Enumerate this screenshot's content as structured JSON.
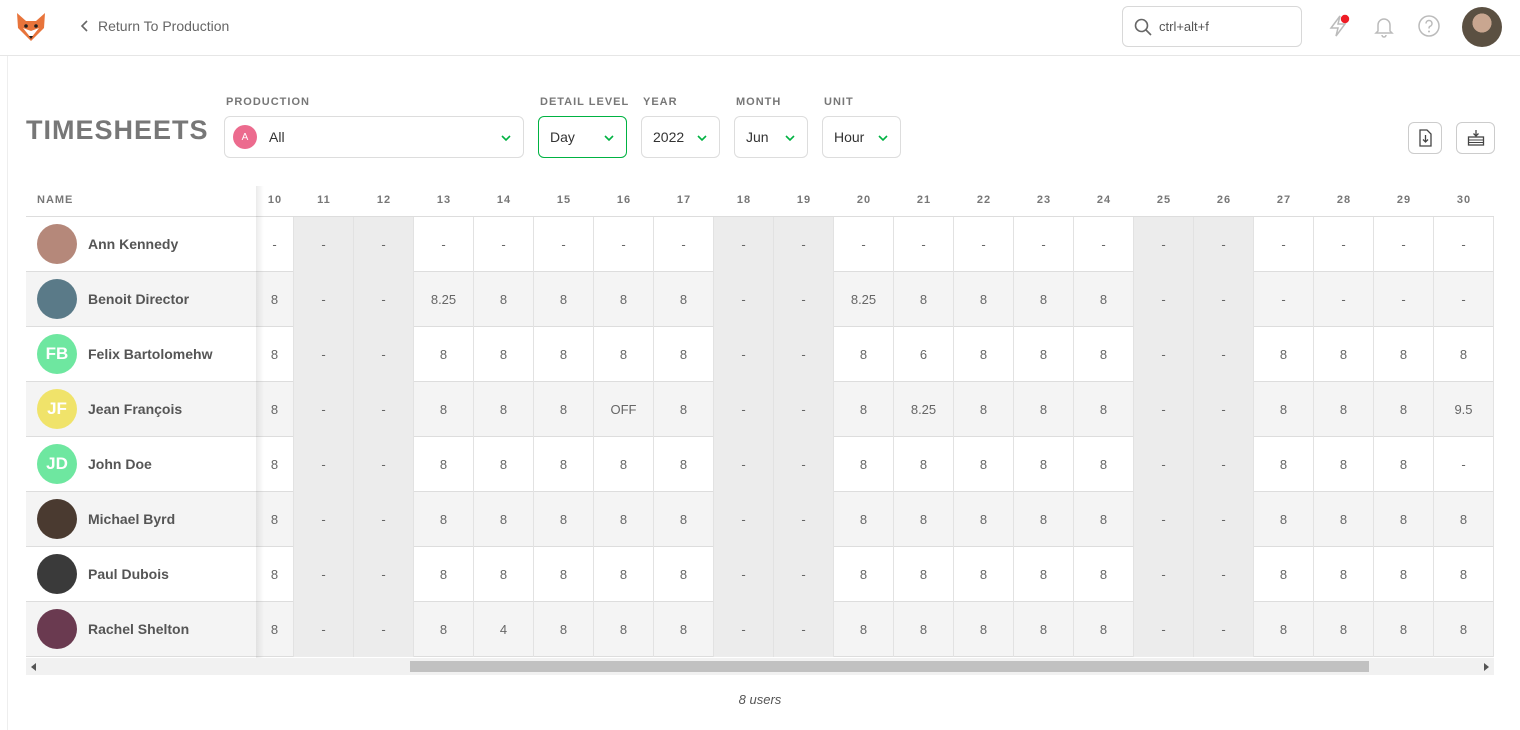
{
  "topbar": {
    "back_label": "Return To Production",
    "search_placeholder": "ctrl+alt+f"
  },
  "page": {
    "title": "TIMESHEETS"
  },
  "filters": {
    "production": {
      "label": "PRODUCTION",
      "value": "All",
      "badge": "A"
    },
    "detail_level": {
      "label": "DETAIL LEVEL",
      "value": "Day"
    },
    "year": {
      "label": "YEAR",
      "value": "2022"
    },
    "month": {
      "label": "MONTH",
      "value": "Jun"
    },
    "unit": {
      "label": "UNIT",
      "value": "Hour"
    }
  },
  "table": {
    "name_header": "NAME",
    "days": [
      "10",
      "11",
      "12",
      "13",
      "14",
      "15",
      "16",
      "17",
      "18",
      "19",
      "20",
      "21",
      "22",
      "23",
      "24",
      "25",
      "26",
      "27",
      "28",
      "29",
      "30"
    ],
    "weekend_indices": [
      1,
      2,
      8,
      9,
      15,
      16
    ],
    "people": [
      {
        "name": "Ann Kennedy",
        "initials": "",
        "color": "#b5887a",
        "hours": [
          "-",
          "-",
          "-",
          "-",
          "-",
          "-",
          "-",
          "-",
          "-",
          "-",
          "-",
          "-",
          "-",
          "-",
          "-",
          "-",
          "-",
          "-",
          "-",
          "-",
          "-"
        ]
      },
      {
        "name": "Benoit Director",
        "initials": "",
        "color": "#5a7a88",
        "hours": [
          "8",
          "-",
          "-",
          "8.25",
          "8",
          "8",
          "8",
          "8",
          "-",
          "-",
          "8.25",
          "8",
          "8",
          "8",
          "8",
          "-",
          "-",
          "-",
          "-",
          "-",
          "-"
        ]
      },
      {
        "name": "Felix Bartolomehw",
        "initials": "FB",
        "color": "#6ee7a0",
        "hours": [
          "8",
          "-",
          "-",
          "8",
          "8",
          "8",
          "8",
          "8",
          "-",
          "-",
          "8",
          "6",
          "8",
          "8",
          "8",
          "-",
          "-",
          "8",
          "8",
          "8",
          "8"
        ]
      },
      {
        "name": "Jean François",
        "initials": "JF",
        "color": "#f0e36a",
        "hours": [
          "8",
          "-",
          "-",
          "8",
          "8",
          "8",
          "OFF",
          "8",
          "-",
          "-",
          "8",
          "8.25",
          "8",
          "8",
          "8",
          "-",
          "-",
          "8",
          "8",
          "8",
          "9.5"
        ]
      },
      {
        "name": "John Doe",
        "initials": "JD",
        "color": "#6ee7a0",
        "hours": [
          "8",
          "-",
          "-",
          "8",
          "8",
          "8",
          "8",
          "8",
          "-",
          "-",
          "8",
          "8",
          "8",
          "8",
          "8",
          "-",
          "-",
          "8",
          "8",
          "8",
          "-"
        ]
      },
      {
        "name": "Michael Byrd",
        "initials": "",
        "color": "#4a3a30",
        "hours": [
          "8",
          "-",
          "-",
          "8",
          "8",
          "8",
          "8",
          "8",
          "-",
          "-",
          "8",
          "8",
          "8",
          "8",
          "8",
          "-",
          "-",
          "8",
          "8",
          "8",
          "8"
        ]
      },
      {
        "name": "Paul Dubois",
        "initials": "",
        "color": "#3a3a3a",
        "hours": [
          "8",
          "-",
          "-",
          "8",
          "8",
          "8",
          "8",
          "8",
          "-",
          "-",
          "8",
          "8",
          "8",
          "8",
          "8",
          "-",
          "-",
          "8",
          "8",
          "8",
          "8"
        ]
      },
      {
        "name": "Rachel Shelton",
        "initials": "",
        "color": "#6a3a50",
        "hours": [
          "8",
          "-",
          "-",
          "8",
          "4",
          "8",
          "8",
          "8",
          "-",
          "-",
          "8",
          "8",
          "8",
          "8",
          "8",
          "-",
          "-",
          "8",
          "8",
          "8",
          "8"
        ]
      }
    ]
  },
  "footer": {
    "count": "8 users"
  }
}
